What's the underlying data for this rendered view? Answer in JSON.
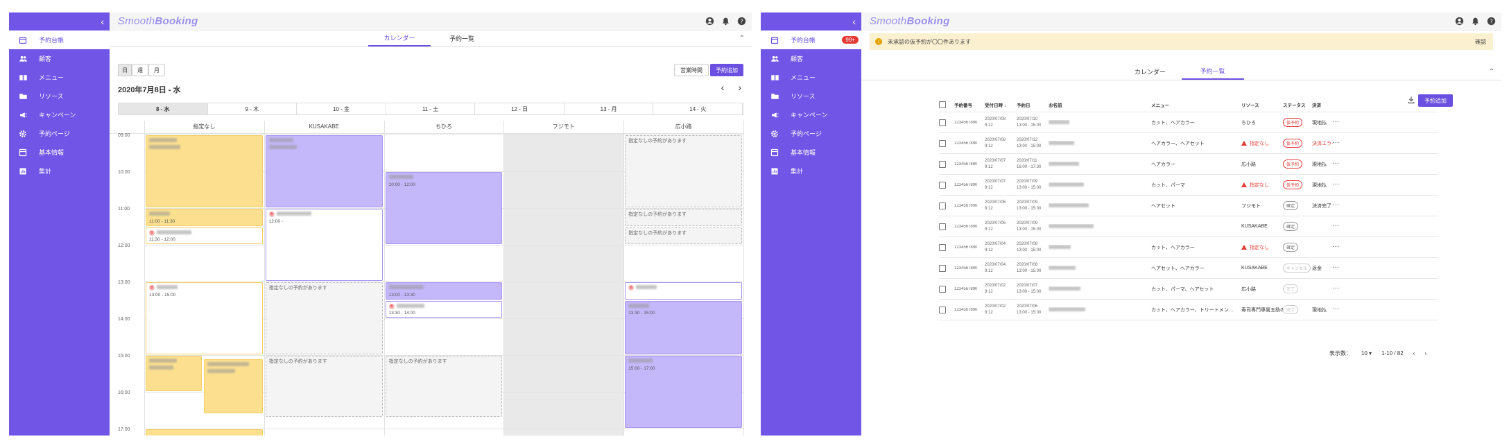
{
  "brand": {
    "logo_light": "Smooth",
    "logo_bold": "Booking",
    "accent": "#7155e6"
  },
  "sidebar": {
    "items": [
      {
        "label": "予約台帳",
        "icon": "calendar-icon"
      },
      {
        "label": "顧客",
        "icon": "people-icon"
      },
      {
        "label": "メニュー",
        "icon": "menu-book-icon"
      },
      {
        "label": "リソース",
        "icon": "folder-icon"
      },
      {
        "label": "キャンペーン",
        "icon": "megaphone-icon"
      },
      {
        "label": "予約ページ",
        "icon": "gear-icon"
      },
      {
        "label": "基本情報",
        "icon": "card-icon"
      },
      {
        "label": "集計",
        "icon": "chart-icon"
      }
    ],
    "badge": "99+"
  },
  "tabs": {
    "calendar": "カレンダー",
    "list": "予約一覧"
  },
  "calendar": {
    "view_buttons": [
      "日",
      "週",
      "月"
    ],
    "business_hours": "営業時間",
    "add_booking": "予約追加",
    "date_title": "2020年7月8日 - 水",
    "prev": "‹",
    "next": "›",
    "days": [
      "8 - 水",
      "9 - 木",
      "10 - 金",
      "11 - 土",
      "12 - 日",
      "13 - 月",
      "14 - 火"
    ],
    "columns": [
      "指定なし",
      "KUSAKABE",
      "ちひろ",
      "フジモト",
      "広小路"
    ],
    "times": [
      "09:00",
      "10:00",
      "11:00",
      "12:00",
      "13:00",
      "14:00",
      "15:00",
      "16:00",
      "17:00"
    ],
    "unassigned": "指定なしの予約があります",
    "ev_times": {
      "a": "11:00 - 11:30",
      "b": "11:30 - 12:00",
      "c": "13:00 - 15:00",
      "d": "12:00 - ",
      "e": "10:00 - 12:00",
      "f": "13:00 - 13:30",
      "g": "13:30 - 14:00",
      "h": "13:30 - 15:00",
      "i": "15:00 - 17:00"
    }
  },
  "list": {
    "banner": "未承認の仮予約が〇〇件あります",
    "banner_confirm": "確認",
    "add_booking": "予約追加",
    "headers": [
      "予約番号",
      "受付日時",
      "予約日",
      "お名前",
      "メニュー",
      "リソース",
      "ステータス",
      "決済"
    ],
    "sort_arrow": "↓",
    "rows": [
      {
        "id": "1234567890",
        "recv": "2020/07/08",
        "recv_t": "9:12",
        "date": "2020/07/10",
        "date_t": "13:00 - 15:00",
        "menu": "カット、ヘアカラー",
        "res": "ちひろ",
        "res_warn": false,
        "status": "仮予約",
        "st": "red",
        "pay": "現地払",
        "pay_warn": false
      },
      {
        "id": "1234567890",
        "recv": "2020/07/08",
        "recv_t": "9:12",
        "date": "2020/07/12",
        "date_t": "13:00 - 15:00",
        "menu": "ヘアカラー、ヘアセット",
        "res": "指定なし",
        "res_warn": true,
        "status": "仮予約",
        "st": "red",
        "pay": "決済エラー",
        "pay_warn": true
      },
      {
        "id": "1234567890",
        "recv": "2020/07/07",
        "recv_t": "9:12",
        "date": "2020/07/11",
        "date_t": "16:00 - 17:30",
        "menu": "ヘアカラー",
        "res": "広小路",
        "res_warn": false,
        "status": "仮予約",
        "st": "red",
        "pay": "現地払",
        "pay_warn": false
      },
      {
        "id": "1234567890",
        "recv": "2020/07/07",
        "recv_t": "9:12",
        "date": "2020/07/09",
        "date_t": "13:00 - 15:00",
        "menu": "カット、パーマ",
        "res": "指定なし",
        "res_warn": true,
        "status": "仮予約",
        "st": "red",
        "pay": "現地払",
        "pay_warn": false
      },
      {
        "id": "1234567890",
        "recv": "2020/07/06",
        "recv_t": "9:12",
        "date": "2020/07/09",
        "date_t": "13:00 - 15:00",
        "menu": "ヘアセット",
        "res": "フジモト",
        "res_warn": false,
        "status": "確定",
        "st": "gry",
        "pay": "決済完了",
        "pay_warn": false
      },
      {
        "id": "1234567890",
        "recv": "2020/07/06",
        "recv_t": "9:12",
        "date": "2020/07/09",
        "date_t": "13:00 - 15:00",
        "menu": "",
        "res": "KUSAKABE",
        "res_warn": false,
        "status": "確定",
        "st": "gry",
        "pay": "",
        "pay_warn": false
      },
      {
        "id": "1234567890",
        "recv": "2020/07/04",
        "recv_t": "9:12",
        "date": "2020/07/08",
        "date_t": "13:00 - 15:00",
        "menu": "カット、ヘアカラー",
        "res": "指定なし",
        "res_warn": true,
        "status": "確定",
        "st": "gry",
        "pay": "",
        "pay_warn": false
      },
      {
        "id": "1234567890",
        "recv": "2020/07/04",
        "recv_t": "9:12",
        "date": "2020/07/08",
        "date_t": "13:00 - 15:00",
        "menu": "ヘアセット、ヘアカラー",
        "res": "KUSAKABE",
        "res_warn": false,
        "status": "キャンセル",
        "st": "lgt",
        "pay": "返金",
        "pay_warn": false
      },
      {
        "id": "1234567890",
        "recv": "2020/07/02",
        "recv_t": "9:12",
        "date": "2020/07/07",
        "date_t": "13:00 - 15:00",
        "menu": "カット、パーマ、ヘアセット",
        "res": "広小路",
        "res_warn": false,
        "status": "完了",
        "st": "lgt",
        "pay": "",
        "pay_warn": false
      },
      {
        "id": "1234567890",
        "recv": "2020/07/02",
        "recv_t": "9:12",
        "date": "2020/07/06",
        "date_t": "13:00 - 15:00",
        "menu": "カット、ヘアカラー、トリートメン…",
        "res": "寿司専門専属五助の握り切れ海鮮料理…",
        "res_warn": false,
        "status": "完了",
        "st": "lgt",
        "pay": "現地払",
        "pay_warn": false
      }
    ],
    "per_page_label": "表示数：",
    "per_page": "10",
    "range": "1-10 / 82"
  }
}
